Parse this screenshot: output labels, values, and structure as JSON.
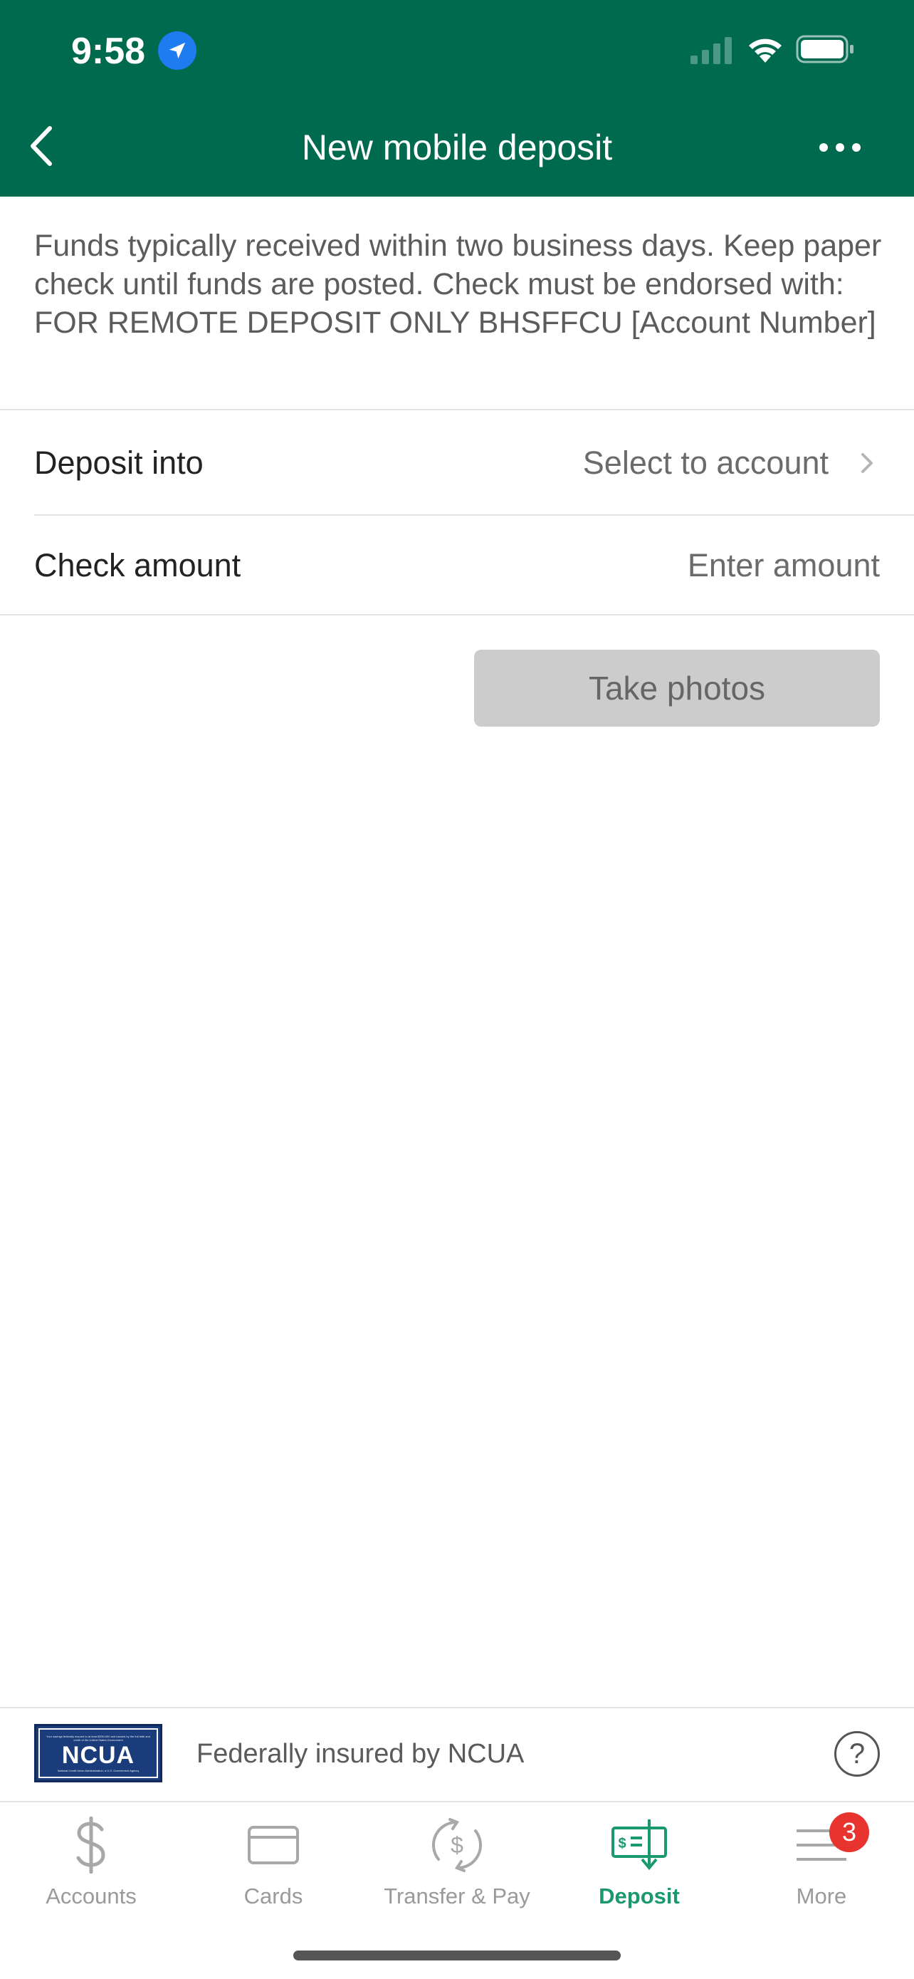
{
  "status_bar": {
    "time": "9:58"
  },
  "nav": {
    "title": "New mobile deposit"
  },
  "info_text": "Funds typically received within two business days. Keep paper check until funds are posted. Check must be endorsed with: FOR REMOTE DEPOSIT ONLY BHSFFCU [Account Number]",
  "form": {
    "deposit_into": {
      "label": "Deposit into",
      "value": "Select to account"
    },
    "check_amount": {
      "label": "Check amount",
      "placeholder": "Enter amount"
    }
  },
  "take_photos_label": "Take photos",
  "footer": {
    "ncua_logo_text": "NCUA",
    "ncua_tiny_top": "Your savings federally insured to at least $250,000 and backed by the full faith and credit of the United States Government",
    "ncua_tiny_bottom": "National Credit Union Administration, a U.S. Government Agency",
    "insured_text": "Federally insured by NCUA",
    "help_glyph": "?"
  },
  "tabs": [
    {
      "label": "Accounts",
      "icon": "dollar-icon",
      "active": false
    },
    {
      "label": "Cards",
      "icon": "card-icon",
      "active": false
    },
    {
      "label": "Transfer & Pay",
      "icon": "transfer-icon",
      "active": false
    },
    {
      "label": "Deposit",
      "icon": "deposit-check-icon",
      "active": true
    },
    {
      "label": "More",
      "icon": "menu-icon",
      "active": false,
      "badge": "3"
    }
  ],
  "colors": {
    "header_bg": "#006a4e",
    "active_tab": "#1a9a6c",
    "badge": "#e8342f",
    "button_disabled": "#cccccc"
  }
}
